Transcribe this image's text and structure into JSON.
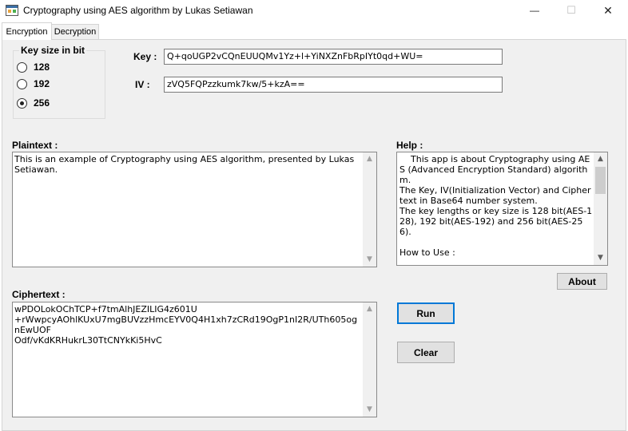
{
  "window": {
    "title": "Cryptography using AES algorithm by Lukas Setiawan",
    "controls": {
      "minimize": "—",
      "maximize": "☐",
      "close": "✕"
    }
  },
  "tabs": [
    {
      "label": "Encryption",
      "selected": true
    },
    {
      "label": "Decryption",
      "selected": false
    }
  ],
  "key_size": {
    "title": "Key size in bit",
    "options": [
      {
        "label": "128",
        "checked": false
      },
      {
        "label": "192",
        "checked": false
      },
      {
        "label": "256",
        "checked": true
      }
    ]
  },
  "key": {
    "label": "Key :",
    "value": "Q+qoUGP2vCQnEUUQMv1Yz+l+YiNXZnFbRpIYt0qd+WU="
  },
  "iv": {
    "label": "IV :",
    "value": "zVQ5FQPzzkumk7kw/5+kzA=="
  },
  "plaintext": {
    "label": "Plaintext :",
    "value": "This is an example of Cryptography using AES algorithm, presented by Lukas Setiawan."
  },
  "help": {
    "label": "Help :",
    "value": "    This app is about Cryptography using AES (Advanced Encryption Standard) algorithm.\nThe Key, IV(Initialization Vector) and Ciphertext in Base64 number system.\nThe key lengths or key size is 128 bit(AES-128), 192 bit(AES-192) and 256 bit(AES-256).\n\nHow to Use :\n\nRun Demo\n-Just click Run button."
  },
  "ciphertext": {
    "label": "Ciphertext :",
    "value": "wPDOLokOChTCP+f7tmAlhJEZILIG4z601U\n+rWwpcyAOhlKUxU7mgBUVzzHmcEYV0Q4H1xh7zCRd19OgP1nI2R/UTh605ognEwUOF\nOdf/vKdKRHukrL30TtCNYkKi5HvC"
  },
  "buttons": {
    "about": "About",
    "run": "Run",
    "clear": "Clear"
  },
  "icons": {
    "app": "app-window-icon",
    "scroll_up": "chevron-up-icon",
    "scroll_down": "chevron-down-icon"
  }
}
